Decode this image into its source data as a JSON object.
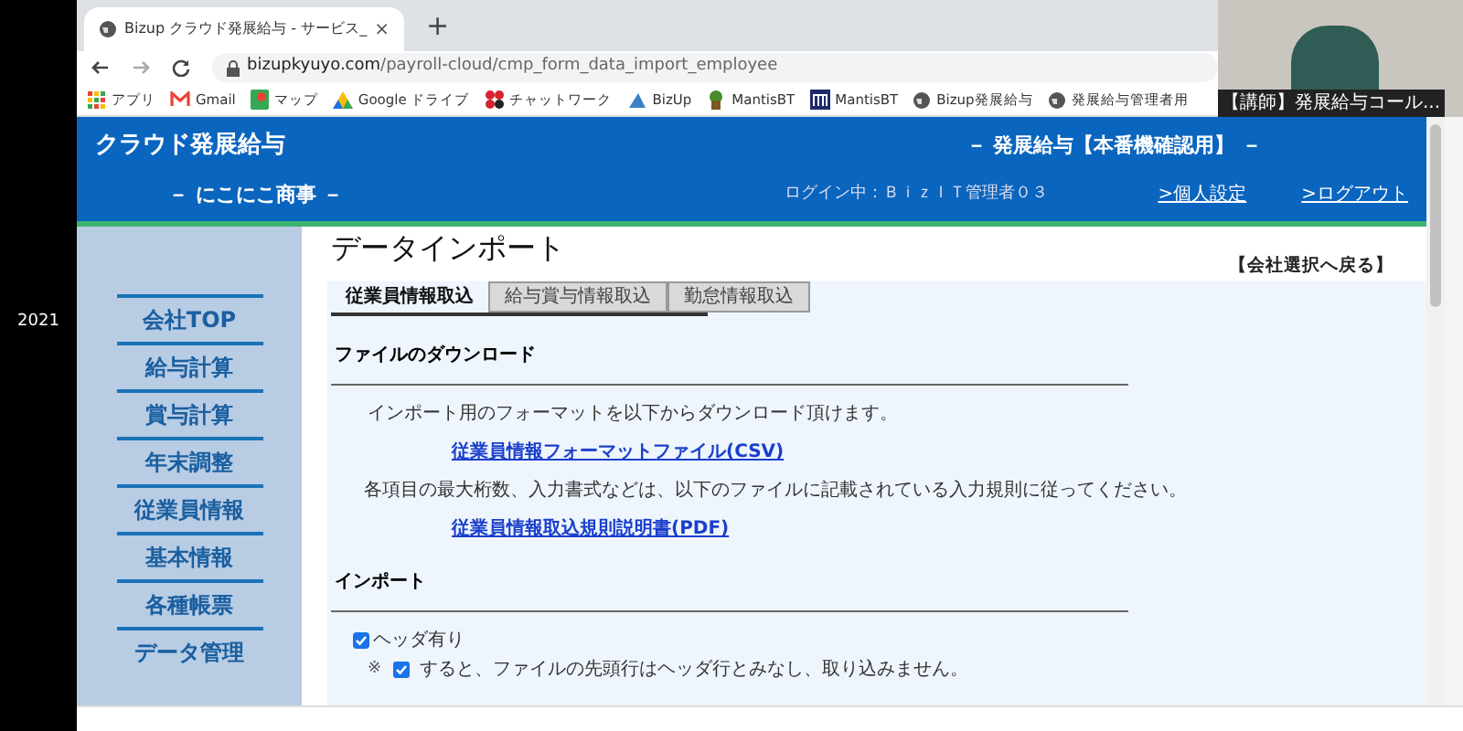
{
  "desktop": {
    "side_text": "2021"
  },
  "browser": {
    "tab_title": "Bizup クラウド発展給与 - サービス_",
    "tab_close": "×",
    "new_tab": "+",
    "url_domain": "bizupkyuyo.com",
    "url_path": "/payroll-cloud/cmp_form_data_import_employee",
    "bookmarks": [
      {
        "label": "アプリ",
        "kind": "apps"
      },
      {
        "label": "Gmail",
        "kind": "mail"
      },
      {
        "label": "マップ",
        "kind": "map"
      },
      {
        "label": "Google ドライブ",
        "kind": "drive"
      },
      {
        "label": "チャットワーク",
        "kind": "chat"
      },
      {
        "label": "BizUp",
        "kind": "bizup"
      },
      {
        "label": "MantisBT",
        "kind": "mantis"
      },
      {
        "label": "MantisBT",
        "kind": "mletter"
      },
      {
        "label": "Bizup発展給与",
        "kind": "globe"
      },
      {
        "label": "発展給与管理者用",
        "kind": "globe"
      }
    ]
  },
  "video": {
    "caption": "【講師】発展給与コール..."
  },
  "header": {
    "logo": "クラウド発展給与",
    "company": "－ にこにこ商事 －",
    "environment": "－ 発展給与【本番機確認用】 －",
    "login": "ログイン中：ＢｉｚＩＴ管理者０３",
    "links": [
      ">個人設定",
      ">ログアウト"
    ]
  },
  "sidebar": {
    "items": [
      "会社TOP",
      "給与計算",
      "賞与計算",
      "年末調整",
      "従業員情報",
      "基本情報",
      "各種帳票",
      "データ管理"
    ]
  },
  "page": {
    "title": "データインポート",
    "back_link": "【会社選択へ戻る】",
    "tabs": [
      {
        "label": "従業員情報取込",
        "selected": true
      },
      {
        "label": "給与賞与情報取込",
        "selected": false
      },
      {
        "label": "勤怠情報取込",
        "selected": false
      }
    ],
    "download": {
      "heading": "ファイルのダウンロード",
      "intro": "インポート用のフォーマットを以下からダウンロード頂けます。",
      "format_link": "従業員情報フォーマットファイル(CSV)",
      "rules_text": "各項目の最大桁数、入力書式などは、以下のファイルに記載されている入力規則に従ってください。",
      "rules_link": "従業員情報取込規則説明書(PDF)"
    },
    "import": {
      "heading": "インポート",
      "header_checkbox": {
        "label": "ヘッダ有り",
        "checked": true
      },
      "note_mark": "※",
      "note": "すると、ファイルの先頭行はヘッダ行とみなし、取り込みません。"
    }
  }
}
